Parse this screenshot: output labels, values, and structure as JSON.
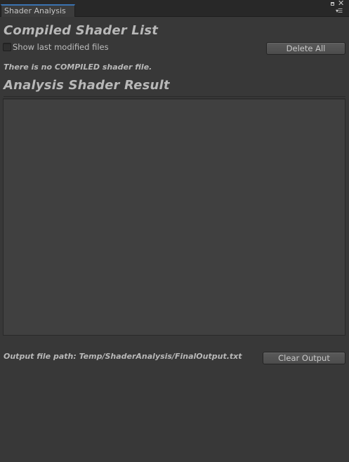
{
  "window": {
    "tab_title": "Shader Analysis",
    "menu_icon": "window-menu-icon",
    "maximize_icon": "maximize-icon",
    "close_icon": "close-icon"
  },
  "compiled": {
    "title": "Compiled Shader List",
    "checkbox_label": "Show last modified files",
    "checkbox_checked": false,
    "delete_all_label": "Delete All",
    "status_text": "There is no COMPILED shader file."
  },
  "analysis": {
    "title": "Analysis Shader Result",
    "result_text": ""
  },
  "output": {
    "path_text": "Output file path: Temp/ShaderAnalysis/FinalOutput.txt",
    "clear_label": "Clear Output"
  }
}
